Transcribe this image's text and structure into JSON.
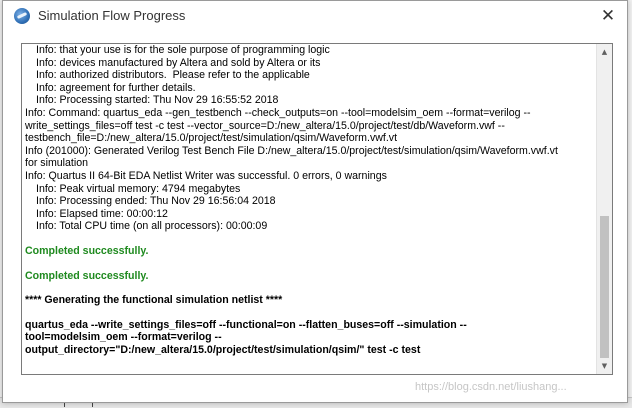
{
  "window": {
    "title": "Simulation Flow Progress",
    "close_glyph": "✕"
  },
  "log": {
    "lines": [
      "Info: that your use is for the sole purpose of programming logic",
      "Info: devices manufactured by Altera and sold by Altera or its",
      "Info: authorized distributors.  Please refer to the applicable",
      "Info: agreement for further details.",
      "Info: Processing started: Thu Nov 29 16:55:52 2018",
      "Info: Command: quartus_eda --gen_testbench --check_outputs=on --tool=modelsim_oem --format=verilog --",
      "write_settings_files=off test -c test --vector_source=D:/new_altera/15.0/project/test/db/Waveform.vwf --",
      "testbench_file=D:/new_altera/15.0/project/test/simulation/qsim/Waveform.vwf.vt",
      "Info (201000): Generated Verilog Test Bench File D:/new_altera/15.0/project/test/simulation/qsim/Waveform.vwf.vt",
      "for simulation",
      "Info: Quartus II 64-Bit EDA Netlist Writer was successful. 0 errors, 0 warnings",
      "Info: Peak virtual memory: 4794 megabytes",
      "Info: Processing ended: Thu Nov 29 16:56:04 2018",
      "Info: Elapsed time: 00:00:12",
      "Info: Total CPU time (on all processors): 00:00:09",
      "Completed successfully.",
      "Completed successfully.",
      "**** Generating the functional simulation netlist ****",
      "quartus_eda --write_settings_files=off --functional=on --flatten_buses=off --simulation --",
      "tool=modelsim_oem --format=verilog --",
      "output_directory=\"D:/new_altera/15.0/project/test/simulation/qsim/\" test -c test"
    ]
  },
  "scrollbar": {
    "up_glyph": "▲",
    "down_glyph": "▼"
  },
  "watermark": "https://blog.csdn.net/liushang..."
}
